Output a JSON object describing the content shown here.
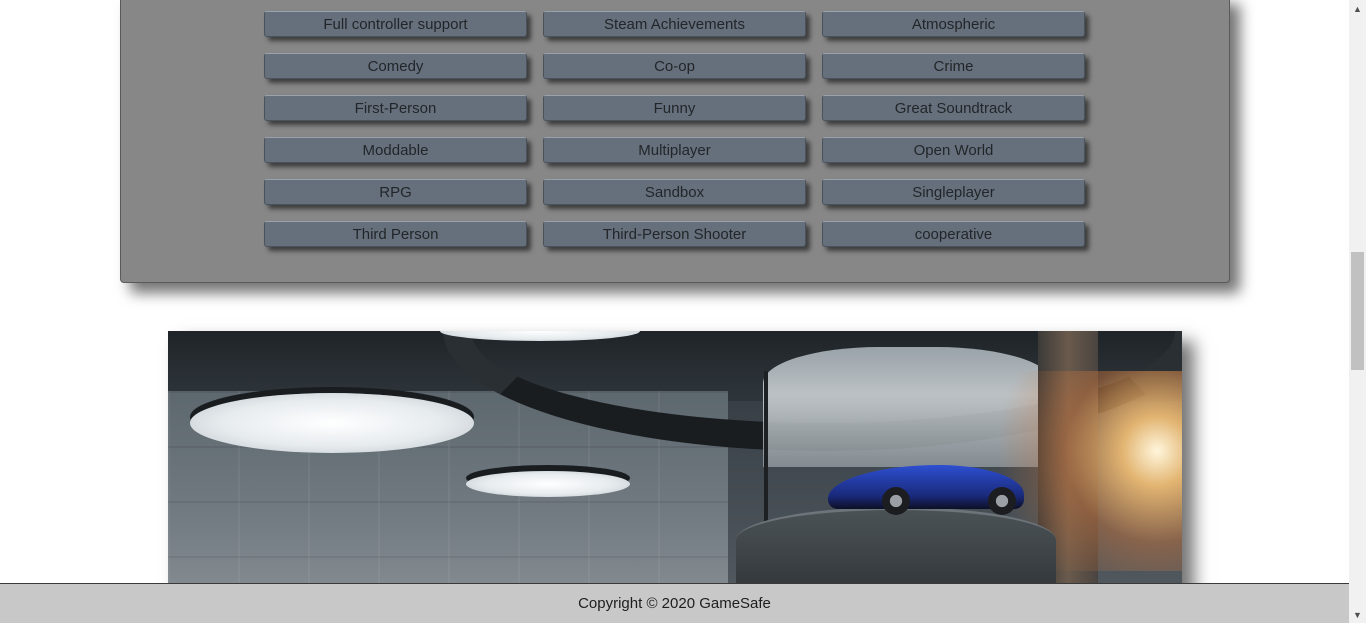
{
  "tags": [
    "Full controller support",
    "Steam Achievements",
    "Atmospheric",
    "Comedy",
    "Co-op",
    "Crime",
    "First-Person",
    "Funny",
    "Great Soundtrack",
    "Moddable",
    "Multiplayer",
    "Open World",
    "RPG",
    "Sandbox",
    "Singleplayer",
    "Third Person",
    "Third-Person Shooter",
    "cooperative"
  ],
  "showcase": {
    "alt": "Futuristic garage with blue sports car"
  },
  "footer": {
    "copyright": "Copyright © 2020 GameSafe"
  },
  "scrollbar": {
    "up_glyph": "▲",
    "down_glyph": "▼"
  }
}
